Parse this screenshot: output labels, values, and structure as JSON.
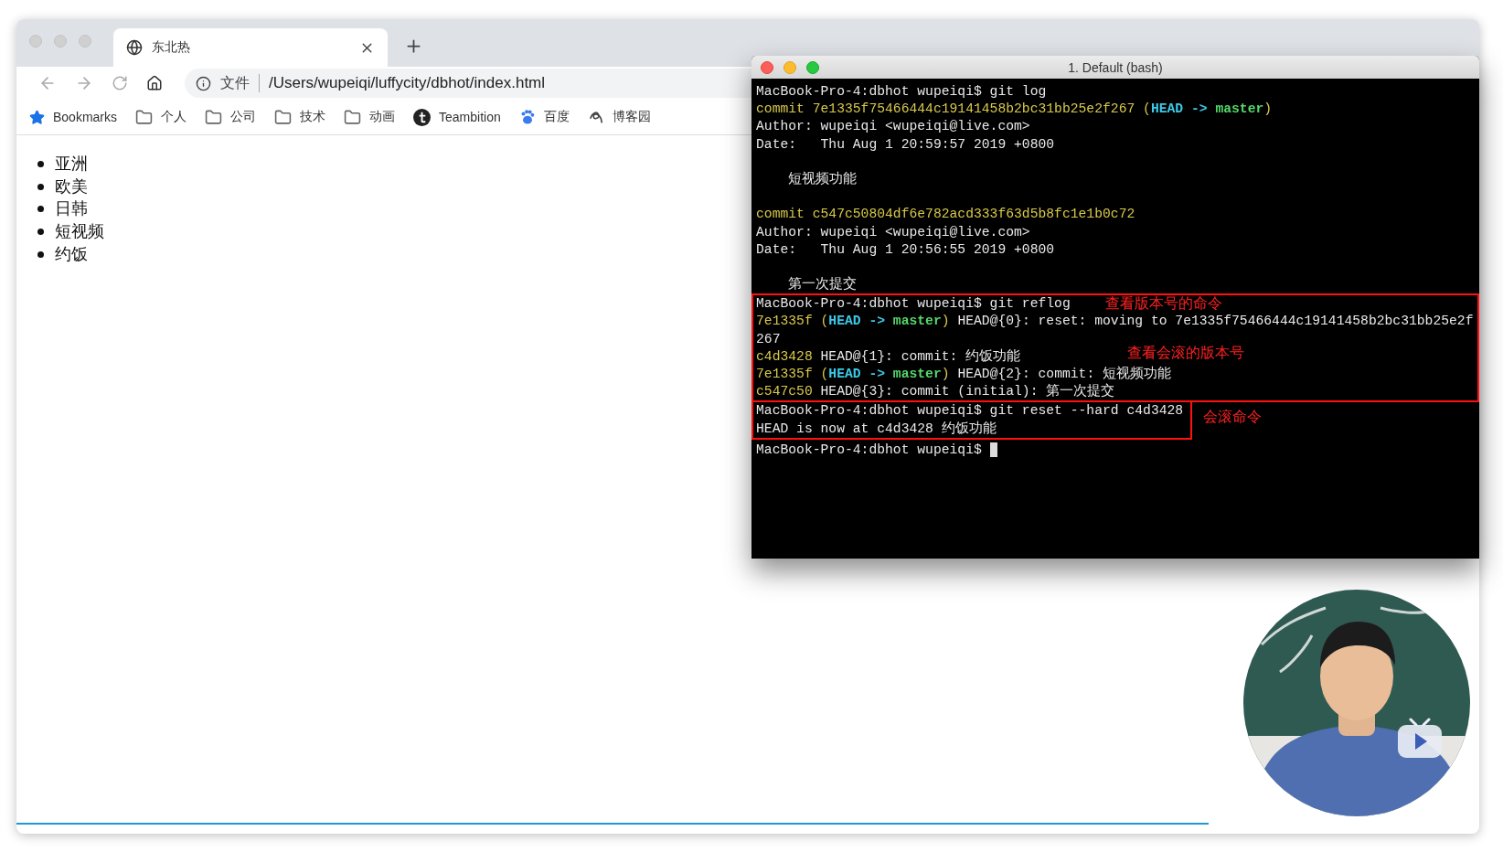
{
  "browser": {
    "tab": {
      "title": "东北热",
      "selected": true
    },
    "address": {
      "scheme": "文件",
      "url": "/Users/wupeiqi/luffycity/dbhot/index.html"
    },
    "bookmarks": [
      {
        "label": "Bookmarks",
        "kind": "star"
      },
      {
        "label": "个人",
        "kind": "folder"
      },
      {
        "label": "公司",
        "kind": "folder"
      },
      {
        "label": "技术",
        "kind": "folder"
      },
      {
        "label": "动画",
        "kind": "folder"
      },
      {
        "label": "Teambition",
        "kind": "teambition"
      },
      {
        "label": "百度",
        "kind": "paw"
      },
      {
        "label": "博客园",
        "kind": "squiggle"
      }
    ],
    "page": {
      "list": [
        "亚洲",
        "欧美",
        "日韩",
        "短视频",
        "约饭"
      ]
    },
    "progress": {
      "level": 0.815
    }
  },
  "terminal": {
    "title": "1. Default (bash)",
    "blocks": [
      {
        "highlighted": false,
        "lines": [
          {
            "kind": "text",
            "segments": [
              {
                "text": "MacBook-Pro-4:dbhot wupeiqi$ git log",
                "kind": "plain"
              }
            ]
          },
          {
            "kind": "text",
            "segments": [
              {
                "text": "commit 7e1335f75466444c19141458b2bc31bb25e2f267 (",
                "kind": "hash"
              },
              {
                "text": "HEAD -> ",
                "kind": "head"
              },
              {
                "text": "master",
                "kind": "branch"
              },
              {
                "text": ")",
                "kind": "hash"
              }
            ]
          },
          {
            "kind": "text",
            "segments": [
              {
                "text": "Author: wupeiqi <wupeiqi@live.com>",
                "kind": "plain"
              }
            ]
          },
          {
            "kind": "text",
            "segments": [
              {
                "text": "Date:   Thu Aug 1 20:59:57 2019 +0800",
                "kind": "plain"
              }
            ]
          },
          {
            "kind": "blank"
          },
          {
            "kind": "text",
            "segments": [
              {
                "text": "短视频功能",
                "kind": "message"
              }
            ]
          },
          {
            "kind": "blank"
          },
          {
            "kind": "text",
            "segments": [
              {
                "text": "commit c547c50804df6e782acd333f63d5b8fc1e1b0c72",
                "kind": "hash"
              }
            ]
          },
          {
            "kind": "text",
            "segments": [
              {
                "text": "Author: wupeiqi <wupeiqi@live.com>",
                "kind": "plain"
              }
            ]
          },
          {
            "kind": "text",
            "segments": [
              {
                "text": "Date:   Thu Aug 1 20:56:55 2019 +0800",
                "kind": "plain"
              }
            ]
          },
          {
            "kind": "blank"
          },
          {
            "kind": "text",
            "segments": [
              {
                "text": "第一次提交",
                "kind": "message"
              }
            ]
          }
        ]
      },
      {
        "highlighted": true,
        "lines": [
          {
            "kind": "text",
            "note": "查看版本号的命令",
            "segments": [
              {
                "text": "MacBook-Pro-4:dbhot wupeiqi$ git reflog",
                "kind": "plain"
              }
            ]
          },
          {
            "kind": "text",
            "segments": [
              {
                "text": "7e1335f (",
                "kind": "hash"
              },
              {
                "text": "HEAD -> ",
                "kind": "head"
              },
              {
                "text": "master",
                "kind": "branch"
              },
              {
                "text": ")",
                "kind": "hash"
              },
              {
                "text": " HEAD@{0}: reset: moving to 7e1335f75466444c19141458b2bc31bb25e2f",
                "kind": "plain"
              }
            ]
          },
          {
            "kind": "text",
            "segments": [
              {
                "text": "267",
                "kind": "plain"
              }
            ]
          },
          {
            "kind": "text",
            "note": "查看会滚的版本号",
            "segments": [
              {
                "text": "c4d3428",
                "kind": "hash"
              },
              {
                "text": " HEAD@{1}: commit: 约饭功能",
                "kind": "plain"
              }
            ]
          },
          {
            "kind": "text",
            "segments": [
              {
                "text": "7e1335f (",
                "kind": "hash"
              },
              {
                "text": "HEAD -> ",
                "kind": "head"
              },
              {
                "text": "master",
                "kind": "branch"
              },
              {
                "text": ")",
                "kind": "hash"
              },
              {
                "text": " HEAD@{2}: commit: 短视频功能",
                "kind": "plain"
              }
            ]
          },
          {
            "kind": "text",
            "segments": [
              {
                "text": "c547c50",
                "kind": "hash"
              },
              {
                "text": " HEAD@{3}: commit (initial): 第一次提交",
                "kind": "plain"
              }
            ]
          }
        ]
      },
      {
        "highlighted": true,
        "note": "会滚命令",
        "lines": [
          {
            "kind": "text",
            "segments": [
              {
                "text": "MacBook-Pro-4:dbhot wupeiqi$ git reset --hard c4d3428",
                "kind": "plain"
              }
            ]
          },
          {
            "kind": "text",
            "segments": [
              {
                "text": "HEAD is now at c4d3428 约饭功能",
                "kind": "plain"
              }
            ]
          }
        ]
      },
      {
        "highlighted": false,
        "lines": [
          {
            "kind": "text",
            "cursor": true,
            "segments": [
              {
                "text": "MacBook-Pro-4:dbhot wupeiqi$ ",
                "kind": "plain"
              }
            ]
          }
        ]
      }
    ]
  }
}
